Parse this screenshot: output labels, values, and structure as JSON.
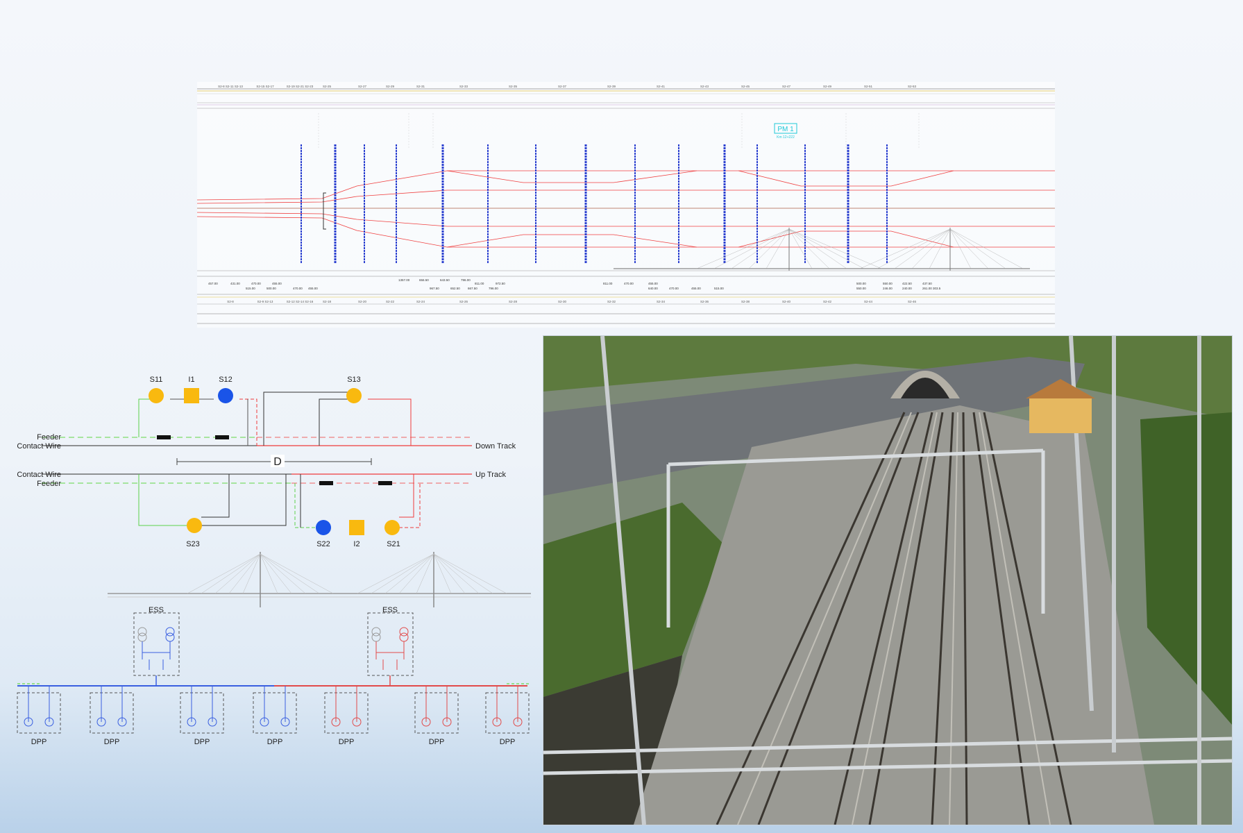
{
  "track_plan": {
    "pm_label": "PM 1",
    "pm_sub": "Km 12+222",
    "top_codes": [
      "S2-8 S2-11 S2-13",
      "S2-15 S2-17",
      "S2-19 S2-21 S2-23",
      "S2-25",
      "S2-27",
      "S2-29",
      "S2-31",
      "S2-33",
      "S2-35",
      "S2-37",
      "S2-39",
      "S2-41",
      "S2-43",
      "S2-45",
      "S2-47",
      "S2-49",
      "S2-51",
      "S2-53"
    ],
    "bottom_codes": [
      "S2-8",
      "S2-9 S2-13",
      "S2-12 S2-14 S2-16",
      "S2-18",
      "S2-20",
      "S2-22",
      "S2-24",
      "S2-26",
      "S2-28",
      "S2-30",
      "S2-32",
      "S2-34",
      "S2-36",
      "S2-38",
      "S2-40",
      "S2-42",
      "S2-44",
      "S2-46"
    ],
    "dimensions": [
      "457.00",
      "431.00",
      "470.00",
      "455.00",
      "515.00",
      "500.00",
      "470.00",
      "455.00",
      "1357.00",
      "656.50",
      "643.50",
      "796.00",
      "811.00",
      "972.50",
      "967.50",
      "652.50",
      "667.50",
      "796.00",
      "811.00",
      "470.00",
      "455.00",
      "640.00",
      "470.00",
      "455.00",
      "515.00",
      "500.00",
      "550.00",
      "422.50",
      "437.50",
      "550.00",
      "246.00",
      "240.00",
      "261.00",
      "303.5"
    ]
  },
  "switching": {
    "stations": {
      "s11": "S11",
      "i1": "I1",
      "s12": "S12",
      "s13": "S13",
      "s23": "S23",
      "s22": "S22",
      "i2": "I2",
      "s21": "S21"
    },
    "labels": {
      "feeder_top": "Feeder",
      "contact_wire_top": "Contact Wire",
      "down_track": "Down Track",
      "d": "D",
      "contact_wire_bottom": "Contact Wire",
      "feeder_bottom": "Feeder",
      "up_track": "Up Track"
    },
    "colors": {
      "circle_yellow": "#f9b90f",
      "circle_blue": "#1a54e8",
      "square_yellow": "#f9b90f",
      "feeder_green": "#5bd14a",
      "track_red": "#ef3b3b"
    }
  },
  "power": {
    "ess_left": "ESS",
    "ess_right": "ESS",
    "dpp_labels": [
      "DPP",
      "DPP",
      "DPP",
      "DPP",
      "DPP",
      "DPP",
      "DPP"
    ],
    "colors": {
      "blue_bus": "#3a5fe0",
      "red_bus": "#e24a4a",
      "green": "#7ddc6a"
    }
  },
  "photo": {
    "description_icon": "railway-photo-icon"
  }
}
